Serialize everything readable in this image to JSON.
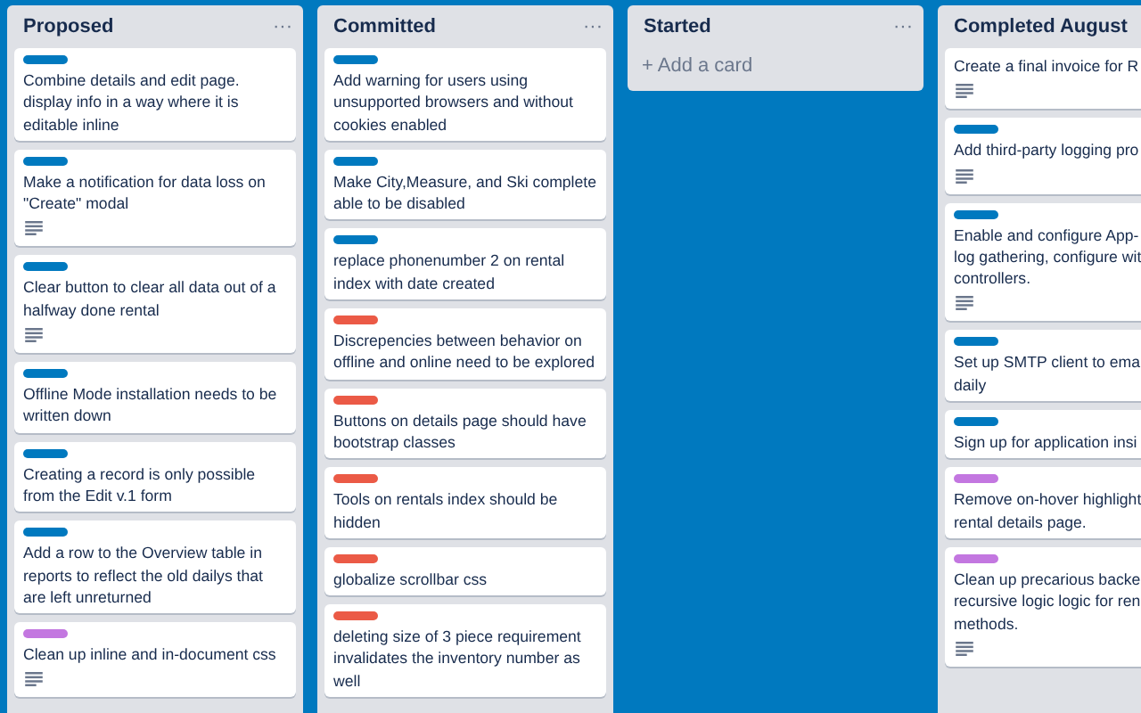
{
  "lists": [
    {
      "title": "Proposed",
      "menu": "···",
      "cards": [
        {
          "color": "#0079bf",
          "lines": [
            "Combine details and edit page.",
            "display info in a way where it is",
            "editable inline"
          ],
          "description": false
        },
        {
          "color": "#0079bf",
          "lines": [
            "Make a notification for data loss on",
            "\"Create\" modal"
          ],
          "description": true
        },
        {
          "color": "#0079bf",
          "lines": [
            "Clear button to clear all data out of a",
            "halfway done rental"
          ],
          "description": true
        },
        {
          "color": "#0079bf",
          "lines": [
            "Offline Mode installation needs to be",
            "written down"
          ],
          "description": false
        },
        {
          "color": "#0079bf",
          "lines": [
            "Creating a record is only possible",
            "from the Edit v.1 form"
          ],
          "description": false
        },
        {
          "color": "#0079bf",
          "lines": [
            "Add a row to the Overview table in",
            "reports to reflect the old dailys that",
            "are left unreturned"
          ],
          "description": false
        },
        {
          "color": "#c377e0",
          "lines": [
            "Clean up inline and in-document css"
          ],
          "description": true
        }
      ]
    },
    {
      "title": "Committed",
      "menu": "···",
      "cards": [
        {
          "color": "#0079bf",
          "lines": [
            "Add warning for users using",
            "unsupported browsers and without",
            "cookies enabled"
          ],
          "description": false
        },
        {
          "color": "#0079bf",
          "lines": [
            "Make City,Measure, and Ski complete",
            "able to be disabled"
          ],
          "description": false
        },
        {
          "color": "#0079bf",
          "lines": [
            "replace phonenumber 2 on rental",
            "index with date created"
          ],
          "description": false
        },
        {
          "color": "#eb5a46",
          "lines": [
            "Discrepencies between behavior on",
            "offline and online need to be explored"
          ],
          "description": false
        },
        {
          "color": "#eb5a46",
          "lines": [
            "Buttons on details page should have",
            "bootstrap classes"
          ],
          "description": false
        },
        {
          "color": "#eb5a46",
          "lines": [
            "Tools on rentals index should be",
            "hidden"
          ],
          "description": false
        },
        {
          "color": "#eb5a46",
          "lines": [
            "globalize scrollbar css"
          ],
          "description": false
        },
        {
          "color": "#eb5a46",
          "lines": [
            "deleting size of 3 piece requirement",
            "invalidates the inventory number as",
            "well"
          ],
          "description": false
        }
      ]
    },
    {
      "title": "Started",
      "menu": "···",
      "add": "+ Add a card"
    },
    {
      "title": "Completed August",
      "cards": [
        {
          "lines": [
            "Create a final invoice for R"
          ],
          "description": true
        },
        {
          "color": "#0079bf",
          "lines": [
            "Add third-party logging pro"
          ],
          "description": true
        },
        {
          "color": "#0079bf",
          "lines": [
            "Enable and configure App-",
            "log gathering, configure wit",
            "controllers."
          ],
          "description": true
        },
        {
          "color": "#0079bf",
          "lines": [
            "Set up SMTP client to ema",
            "daily"
          ],
          "description": false
        },
        {
          "color": "#0079bf",
          "lines": [
            "Sign up for application insi"
          ],
          "description": false
        },
        {
          "color": "#c377e0",
          "lines": [
            "Remove on-hover highlight",
            "rental details page."
          ],
          "description": false
        },
        {
          "color": "#c377e0",
          "lines": [
            "Clean up precarious backe",
            "recursive logic logic for ren",
            "methods."
          ],
          "description": true
        }
      ]
    }
  ]
}
